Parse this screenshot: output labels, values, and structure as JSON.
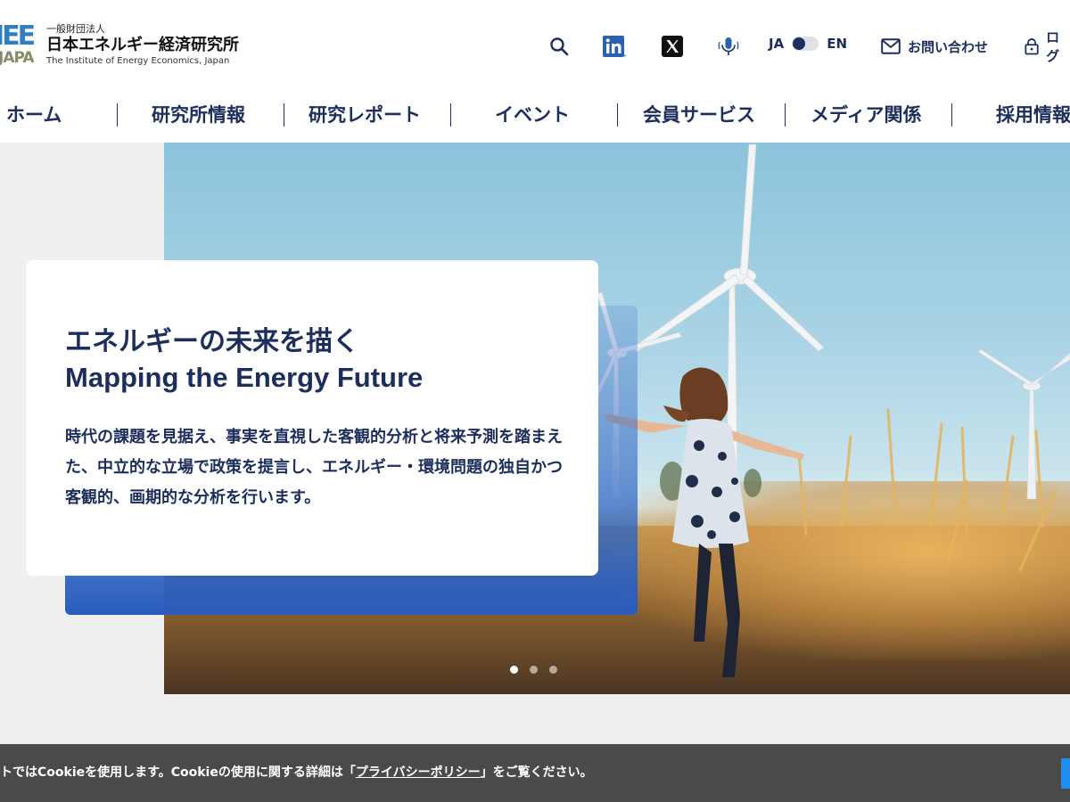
{
  "header": {
    "logo": {
      "mark_top": "IEE",
      "mark_bottom": "JAPAN",
      "sub": "一般財団法人",
      "name": "日本エネルギー経済研究所",
      "name_en": "The Institute of Energy Economics, Japan"
    },
    "utility": {
      "search_icon": "search-icon",
      "linkedin_icon": "linkedin-icon",
      "x_icon": "x-icon",
      "podcast_icon": "microphone-icon",
      "lang_ja": "JA",
      "lang_en": "EN",
      "contact_label": "お問い合わせ",
      "login_label": "ログ"
    }
  },
  "nav": {
    "items": [
      {
        "label": "ホーム"
      },
      {
        "label": "研究所情報"
      },
      {
        "label": "研究レポート"
      },
      {
        "label": "イベント"
      },
      {
        "label": "会員サービス"
      },
      {
        "label": "メディア関係"
      },
      {
        "label": "採用情報"
      }
    ]
  },
  "hero": {
    "title_ja": "エネルギーの未来を描く",
    "title_en": "Mapping the Energy Future",
    "description": "時代の課題を見据え、事実を直視した客観的分析と将来予測を踏まえた、中立的な立場で政策を提言し、エネルギー・環境問題の独自かつ客観的、画期的な分析を行います。",
    "slides": 3,
    "active_slide": 1
  },
  "cookie": {
    "text_before": "トではCookieを使用します。Cookieの使用に関する詳細は「",
    "link": "プライバシーポリシー",
    "text_after": "」をご覧ください。"
  },
  "colors": {
    "brand_navy": "#1c2e5c",
    "logo_blue": "#2f7fc1",
    "logo_olive": "#8c8a6a",
    "card_blue": "#2a5cbd",
    "cookie_bg": "#4a4a4a",
    "cookie_button": "#1e8ff0"
  }
}
